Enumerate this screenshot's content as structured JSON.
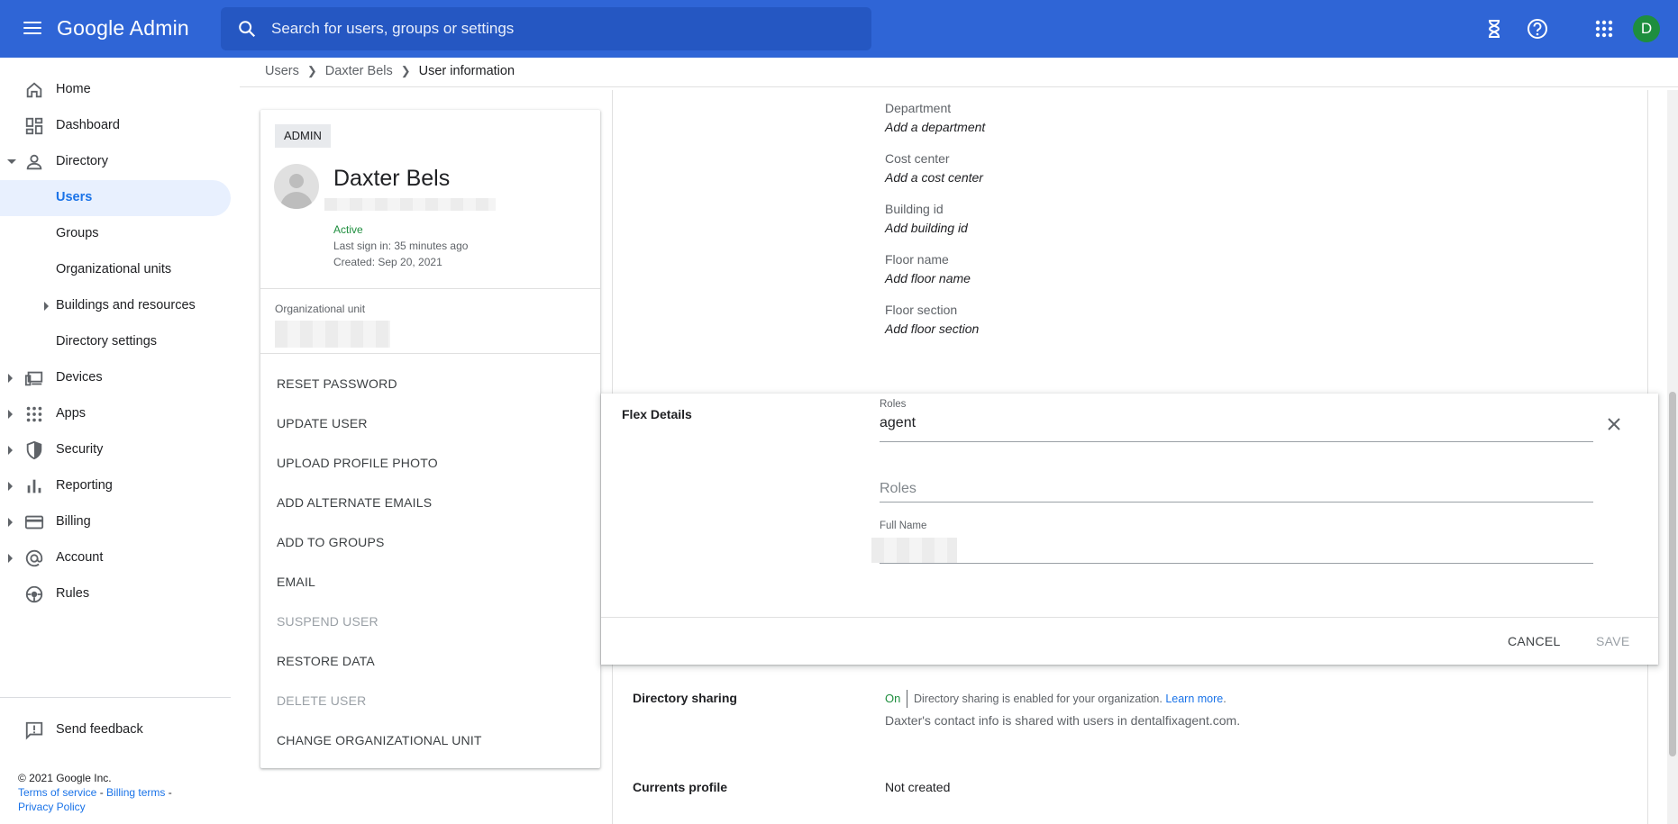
{
  "topbar": {
    "brand": "Google Admin",
    "search_placeholder": "Search for users, groups or settings",
    "avatar_letter": "D"
  },
  "sidebar": {
    "items": [
      {
        "label": "Home",
        "icon": "home-icon"
      },
      {
        "label": "Dashboard",
        "icon": "dashboard-icon"
      },
      {
        "label": "Directory",
        "icon": "person-icon"
      },
      {
        "label": "Users"
      },
      {
        "label": "Groups"
      },
      {
        "label": "Organizational units"
      },
      {
        "label": "Buildings and resources"
      },
      {
        "label": "Directory settings"
      },
      {
        "label": "Devices",
        "icon": "devices-icon"
      },
      {
        "label": "Apps",
        "icon": "apps-grid-icon"
      },
      {
        "label": "Security",
        "icon": "shield-icon"
      },
      {
        "label": "Reporting",
        "icon": "bar-chart-icon"
      },
      {
        "label": "Billing",
        "icon": "credit-card-icon"
      },
      {
        "label": "Account",
        "icon": "at-sign-icon"
      },
      {
        "label": "Rules",
        "icon": "rules-icon"
      }
    ],
    "feedback": "Send feedback",
    "copyright": "© 2021 Google Inc.",
    "terms": "Terms of service",
    "billing_terms": "Billing terms",
    "privacy": "Privacy Policy"
  },
  "breadcrumb": {
    "users": "Users",
    "user": "Daxter Bels",
    "current": "User information"
  },
  "user_card": {
    "badge": "ADMIN",
    "name": "Daxter Bels",
    "status": "Active",
    "last_sign_in": "Last sign in: 35 minutes ago",
    "created": "Created: Sep 20, 2021",
    "ou_label": "Organizational unit",
    "actions": [
      {
        "label": "RESET PASSWORD",
        "enabled": true
      },
      {
        "label": "UPDATE USER",
        "enabled": true
      },
      {
        "label": "UPLOAD PROFILE PHOTO",
        "enabled": true
      },
      {
        "label": "ADD ALTERNATE EMAILS",
        "enabled": true
      },
      {
        "label": "ADD TO GROUPS",
        "enabled": true
      },
      {
        "label": "EMAIL",
        "enabled": true
      },
      {
        "label": "SUSPEND USER",
        "enabled": false
      },
      {
        "label": "RESTORE DATA",
        "enabled": true
      },
      {
        "label": "DELETE USER",
        "enabled": false
      },
      {
        "label": "CHANGE ORGANIZATIONAL UNIT",
        "enabled": true
      }
    ]
  },
  "employee_fields": [
    {
      "label": "Department",
      "value": "Add a department"
    },
    {
      "label": "Cost center",
      "value": "Add a cost center"
    },
    {
      "label": "Building id",
      "value": "Add building id"
    },
    {
      "label": "Floor name",
      "value": "Add floor name"
    },
    {
      "label": "Floor section",
      "value": "Add floor section"
    }
  ],
  "flex_details": {
    "title": "Flex Details",
    "roles_label": "Roles",
    "roles_value": "agent",
    "roles_placeholder": "Roles",
    "fullname_label": "Full Name",
    "cancel": "CANCEL",
    "save": "SAVE"
  },
  "directory_sharing": {
    "title": "Directory sharing",
    "state": "On",
    "text": "Directory sharing is enabled for your organization.",
    "link": "Learn more",
    "period": ".",
    "sub": "Daxter's contact info is shared with users in dentalfixagent.com."
  },
  "currents_profile": {
    "title": "Currents profile",
    "value": "Not created"
  },
  "colors": {
    "topbar": "#2f65d6",
    "accent": "#1a73e8",
    "active_green": "#1e8e3e"
  }
}
